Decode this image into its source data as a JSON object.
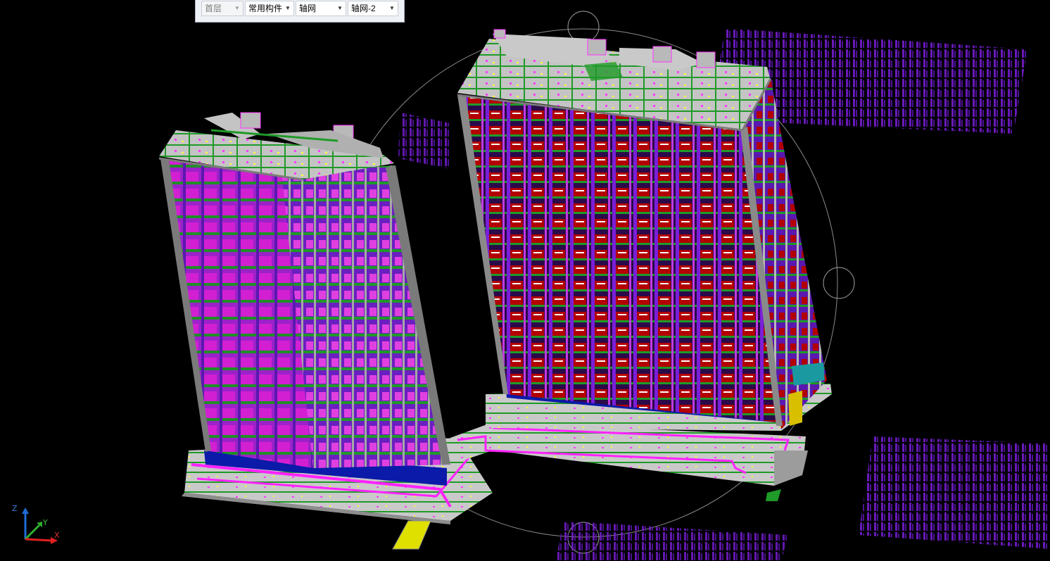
{
  "app": {
    "view": "3D"
  },
  "toolbar": {
    "floor_select": {
      "value": "首层",
      "disabled": true
    },
    "category_select": {
      "value": "常用构件"
    },
    "type_select": {
      "value": "轴网"
    },
    "instance_select": {
      "value": "轴网-2"
    }
  },
  "axis_triad": {
    "z_label": "Z",
    "y_label": "Y",
    "x_label": "X"
  },
  "orbit": {
    "handles": [
      "top",
      "right",
      "bottom"
    ]
  },
  "colors": {
    "background": "#000000",
    "column": "#7a1fd8",
    "wall": "#d21fd2",
    "beam": "#1f9a28",
    "slab": "#bdbdbd",
    "window": "#b30000",
    "base": "#0b1aa8",
    "trench": "#ff22ff",
    "ramp": "#e0e000",
    "orbit_circle": "#8a8a8a"
  },
  "icons": {
    "dropdown": "chevron-down-icon"
  }
}
